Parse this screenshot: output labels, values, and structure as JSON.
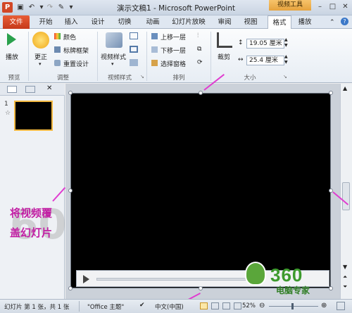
{
  "app": {
    "title": "演示文稿1 - Microsoft PowerPoint",
    "context_tab_group": "视频工具"
  },
  "tabs": [
    "文件",
    "开始",
    "插入",
    "设计",
    "切换",
    "动画",
    "幻灯片放映",
    "审阅",
    "视图",
    "格式",
    "播放"
  ],
  "active_tab": "格式",
  "ribbon": {
    "preview": {
      "play_label": "播放",
      "group_label": "预览"
    },
    "adjust": {
      "update_label": "更正",
      "color_label": "颜色",
      "poster_label": "标牌框架",
      "reset_label": "重置设计",
      "group_label": "调整"
    },
    "video_styles": {
      "styles_label": "视频样式",
      "group_label": "视频样式"
    },
    "arrange": {
      "bring_forward": "上移一层",
      "send_backward": "下移一层",
      "selection_pane": "选择窗格",
      "group_label": "排列"
    },
    "size": {
      "crop_label": "裁剪",
      "height_value": "19.05 厘米",
      "width_value": "25.4 厘米",
      "group_label": "大小"
    }
  },
  "left_panel": {
    "slide_number": "1"
  },
  "overlay": {
    "annotation_line1": "将视频覆",
    "annotation_line2": "盖幻灯片",
    "watermark_number": "360",
    "watermark_text": "电脑专家"
  },
  "status_bar": {
    "slide_info": "幻灯片 第 1 张，共 1 张",
    "theme": "\"Office 主题\"",
    "language": "中文(中国)",
    "zoom": "52%"
  },
  "colors": {
    "file_tab": "#d24726",
    "annotation": "#c21fa4",
    "slide_bg": "#000000",
    "context_tab": "#e6a33e"
  }
}
